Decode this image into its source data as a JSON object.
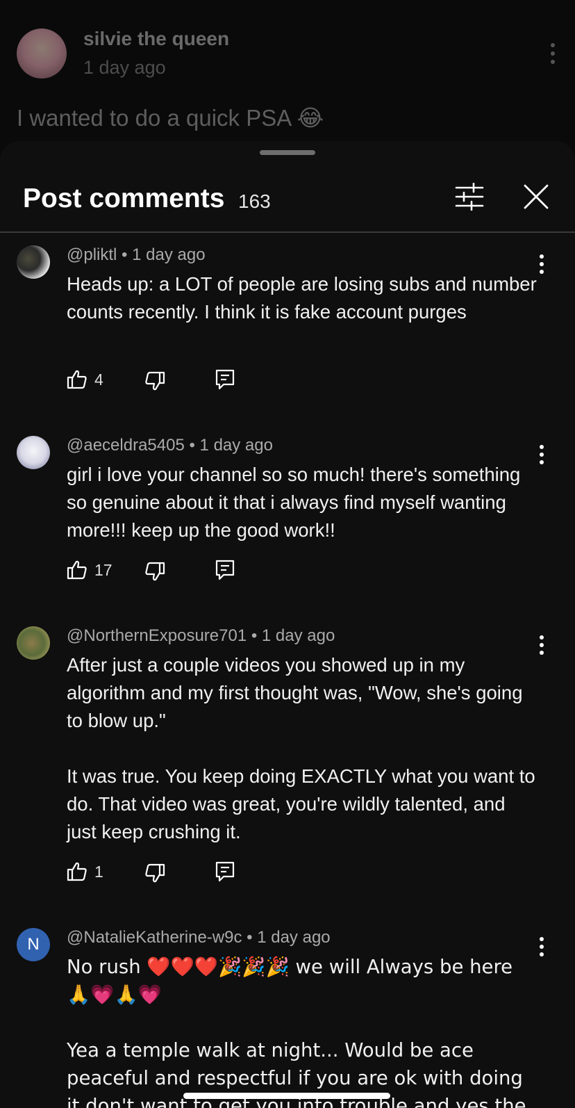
{
  "background_post": {
    "author": "silvie the queen",
    "time": "1 day ago",
    "text": "I wanted to do a quick PSA 😂"
  },
  "sheet": {
    "title": "Post comments",
    "count": "163"
  },
  "comments": [
    {
      "meta": "@pliktl • 1 day ago",
      "text": "Heads up: a LOT of people are losing subs and number counts recently. I think it is fake account purges",
      "likes": "4"
    },
    {
      "meta": "@aeceldra5405 • 1 day ago",
      "text": "girl i love your channel so so much! there's something so genuine about it that i always find myself wanting more!!! keep up the good work!!",
      "likes": "17"
    },
    {
      "meta": "@NorthernExposure701 • 1 day ago",
      "text": "After just a couple videos you showed up in my algorithm and my first thought was, \"Wow, she's going to blow up.\"\n\nIt was true. You keep doing EXACTLY what you want to do. That video was great, you're wildly talented, and just keep crushing it.",
      "likes": "1"
    },
    {
      "meta": "@NatalieKatherine-w9c • 1 day ago",
      "avatar_letter": "N",
      "text": "No rush ❤️❤️❤️🎉🎉🎉 we will Always be here 🙏💗🙏💗\n\nYea a temple walk at night... Would be ace peaceful and respectful if you are ok with doing it don't want to get you into trouble and yes the food video's and"
    }
  ],
  "colors": {
    "sheet_bg": "#0f0f0f",
    "text_primary": "#f1f1f1",
    "text_secondary": "#aaaaaa",
    "avatar_n_bg": "#3162b0"
  }
}
